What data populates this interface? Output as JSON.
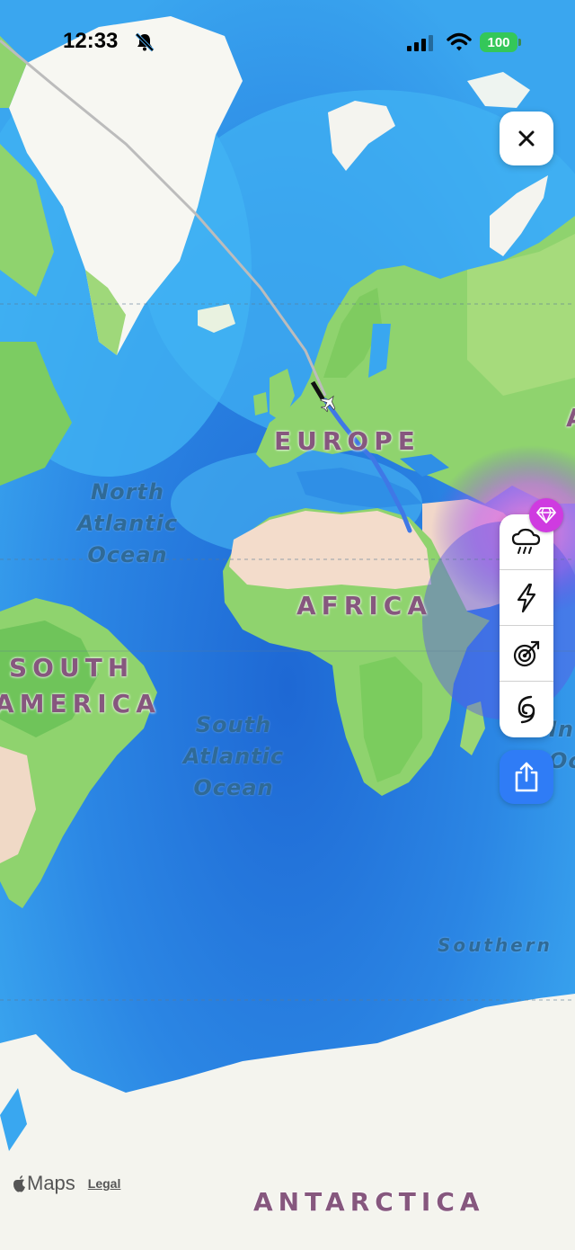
{
  "status_bar": {
    "time": "12:33",
    "battery": "100"
  },
  "map": {
    "continents": {
      "europe": "EUROPE",
      "africa": "AFRICA",
      "south_america_1": "SOUTH",
      "south_america_2": "AMERICA",
      "antarctica": "ANTARCTICA"
    },
    "oceans": {
      "north_atlantic": [
        "North",
        "Atlantic",
        "Ocean"
      ],
      "south_atlantic": [
        "South",
        "Atlantic",
        "Ocean"
      ],
      "southern": "Southern",
      "indian_partial": [
        "In",
        "Oc"
      ],
      "partial_asia": "A"
    }
  },
  "controls": {
    "close_icon": "close-icon",
    "tools": [
      "rain-icon",
      "lightning-icon",
      "radar-target-icon",
      "hurricane-icon"
    ],
    "share_icon": "share-icon",
    "premium_icon": "gem-icon"
  },
  "attribution": {
    "logo": "Maps",
    "legal": "Legal"
  },
  "colors": {
    "ocean_deep": "#1f6fd8",
    "ocean_shallow": "#44b7f5",
    "land_green": "#8fd36e",
    "desert": "#f3d9c8",
    "ice": "#f5f5ef",
    "route_blue": "#3f78e6",
    "label_purple": "#86577e",
    "ocean_label": "#2f6a97",
    "share_blue": "#2f7cf6",
    "gem_magenta": "#cf3be0"
  }
}
